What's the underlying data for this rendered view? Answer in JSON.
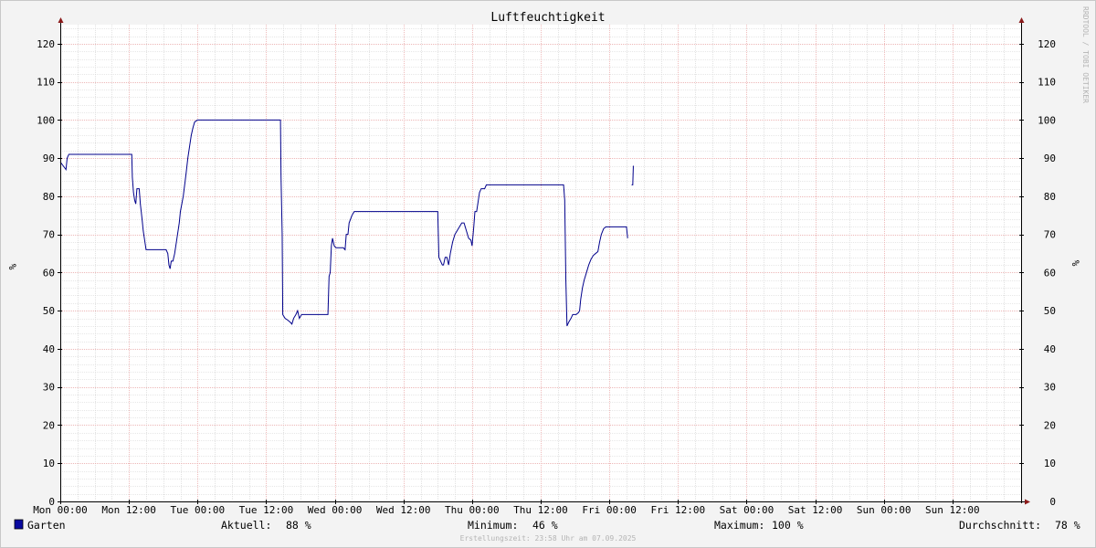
{
  "chart_data": {
    "type": "line",
    "title": "Luftfeuchtigkeit",
    "ylabel": "%",
    "ylim": [
      0,
      125
    ],
    "yticks": [
      0,
      10,
      20,
      30,
      40,
      50,
      60,
      70,
      80,
      90,
      100,
      110,
      120
    ],
    "xrange_hours": [
      0,
      168
    ],
    "xticks": [
      {
        "h": 0,
        "label": "Mon 00:00"
      },
      {
        "h": 12,
        "label": "Mon 12:00"
      },
      {
        "h": 24,
        "label": "Tue 00:00"
      },
      {
        "h": 36,
        "label": "Tue 12:00"
      },
      {
        "h": 48,
        "label": "Wed 00:00"
      },
      {
        "h": 60,
        "label": "Wed 12:00"
      },
      {
        "h": 72,
        "label": "Thu 00:00"
      },
      {
        "h": 84,
        "label": "Thu 12:00"
      },
      {
        "h": 96,
        "label": "Fri 00:00"
      },
      {
        "h": 108,
        "label": "Fri 12:00"
      },
      {
        "h": 120,
        "label": "Sat 00:00"
      },
      {
        "h": 132,
        "label": "Sat 12:00"
      },
      {
        "h": 144,
        "label": "Sun 00:00"
      },
      {
        "h": 156,
        "label": "Sun 12:00"
      }
    ],
    "grid": true,
    "series": [
      {
        "name": "Garten",
        "color": "#00008b",
        "segments": [
          [
            [
              0.0,
              89
            ],
            [
              0.5,
              88
            ],
            [
              1.0,
              87
            ],
            [
              1.2,
              90
            ],
            [
              1.5,
              91
            ],
            [
              5.0,
              91
            ],
            [
              9.0,
              91
            ],
            [
              12.5,
              91
            ],
            [
              12.6,
              85
            ],
            [
              12.8,
              81
            ],
            [
              13.0,
              79
            ],
            [
              13.2,
              78
            ],
            [
              13.4,
              82
            ],
            [
              13.8,
              82
            ],
            [
              14.0,
              78
            ],
            [
              14.3,
              74
            ],
            [
              14.5,
              71
            ],
            [
              14.8,
              68
            ],
            [
              15.0,
              66
            ],
            [
              17.0,
              66
            ],
            [
              18.5,
              66
            ],
            [
              18.8,
              65
            ],
            [
              19.0,
              62
            ],
            [
              19.2,
              61
            ],
            [
              19.4,
              63
            ],
            [
              19.7,
              63
            ],
            [
              20.0,
              65
            ],
            [
              20.3,
              68
            ],
            [
              20.5,
              70
            ],
            [
              20.8,
              73
            ],
            [
              21.0,
              76
            ],
            [
              21.5,
              80
            ],
            [
              22.0,
              86
            ],
            [
              22.3,
              90
            ],
            [
              22.6,
              93
            ],
            [
              22.9,
              96
            ],
            [
              23.2,
              98
            ],
            [
              23.5,
              99.5
            ],
            [
              24.0,
              100
            ],
            [
              30.0,
              100
            ],
            [
              38.5,
              100
            ],
            [
              38.6,
              85
            ],
            [
              38.8,
              70
            ],
            [
              38.9,
              49
            ],
            [
              39.3,
              48
            ],
            [
              39.8,
              47.5
            ],
            [
              40.2,
              47
            ],
            [
              40.5,
              46.5
            ],
            [
              40.8,
              48
            ],
            [
              41.2,
              49
            ],
            [
              41.5,
              50
            ],
            [
              41.8,
              48
            ],
            [
              42.2,
              49
            ],
            [
              45.0,
              49
            ],
            [
              46.8,
              49
            ],
            [
              47.0,
              59
            ],
            [
              47.2,
              60
            ],
            [
              47.4,
              67
            ],
            [
              47.6,
              69
            ],
            [
              47.9,
              67
            ],
            [
              48.2,
              66.5
            ],
            [
              48.6,
              66.5
            ],
            [
              49.0,
              66.5
            ],
            [
              49.5,
              66.5
            ],
            [
              49.8,
              66
            ],
            [
              50.0,
              70
            ],
            [
              50.3,
              70
            ],
            [
              50.5,
              73
            ],
            [
              51.0,
              75
            ],
            [
              51.4,
              76
            ],
            [
              56.0,
              76
            ],
            [
              66.0,
              76
            ],
            [
              66.2,
              64
            ],
            [
              66.5,
              63
            ],
            [
              66.8,
              62
            ],
            [
              67.0,
              62
            ],
            [
              67.3,
              64
            ],
            [
              67.6,
              64
            ],
            [
              67.9,
              62
            ],
            [
              68.2,
              65
            ],
            [
              68.6,
              68
            ],
            [
              69.0,
              70
            ],
            [
              69.6,
              71.5
            ],
            [
              70.2,
              73
            ],
            [
              70.6,
              73
            ],
            [
              71.0,
              71
            ],
            [
              71.4,
              69
            ],
            [
              71.8,
              68.5
            ],
            [
              72.0,
              67
            ],
            [
              72.3,
              72
            ],
            [
              72.5,
              76
            ],
            [
              72.8,
              76
            ],
            [
              73.0,
              78
            ],
            [
              73.3,
              81
            ],
            [
              73.6,
              82
            ],
            [
              74.2,
              82
            ],
            [
              74.5,
              83
            ],
            [
              80.0,
              83
            ],
            [
              88.0,
              83
            ],
            [
              88.2,
              79
            ],
            [
              88.4,
              58
            ],
            [
              88.6,
              46
            ],
            [
              88.9,
              47
            ],
            [
              89.3,
              48
            ],
            [
              89.6,
              49
            ],
            [
              90.2,
              49
            ],
            [
              90.6,
              49.5
            ],
            [
              90.8,
              50
            ],
            [
              91.0,
              53
            ],
            [
              91.3,
              56
            ],
            [
              91.6,
              58
            ],
            [
              92.0,
              60
            ],
            [
              92.4,
              62
            ],
            [
              92.8,
              63.5
            ],
            [
              93.2,
              64.5
            ],
            [
              93.6,
              65
            ],
            [
              94.0,
              65.5
            ],
            [
              94.3,
              68
            ],
            [
              94.6,
              70
            ],
            [
              95.0,
              71.5
            ],
            [
              95.4,
              72
            ],
            [
              98.0,
              72
            ],
            [
              99.0,
              72
            ],
            [
              99.2,
              69
            ]
          ],
          [
            [
              99.9,
              83
            ],
            [
              100.1,
              83
            ],
            [
              100.2,
              88
            ]
          ]
        ]
      }
    ]
  },
  "watermark": "RRDTOOL / TOBI OETIKER",
  "legend": {
    "series_label": "Garten",
    "aktuell_label": "Aktuell:",
    "aktuell_value": "88 %",
    "minimum_label": "Minimum:",
    "minimum_value": "46 %",
    "maximum_label": "Maximum:",
    "maximum_value": "100 %",
    "durchschnitt_label": "Durchschnitt:",
    "durchschnitt_value": "78 %"
  },
  "footer": "Erstellungszeit: 23:58 Uhr am 07.09.2025",
  "colors": {
    "line": "#00008b",
    "major_grid": "#e8a0a0",
    "minor_grid": "#d0d0d0",
    "axis": "#000000",
    "arrow": "#8b1a1a",
    "swatch": "#0a0aa0"
  }
}
